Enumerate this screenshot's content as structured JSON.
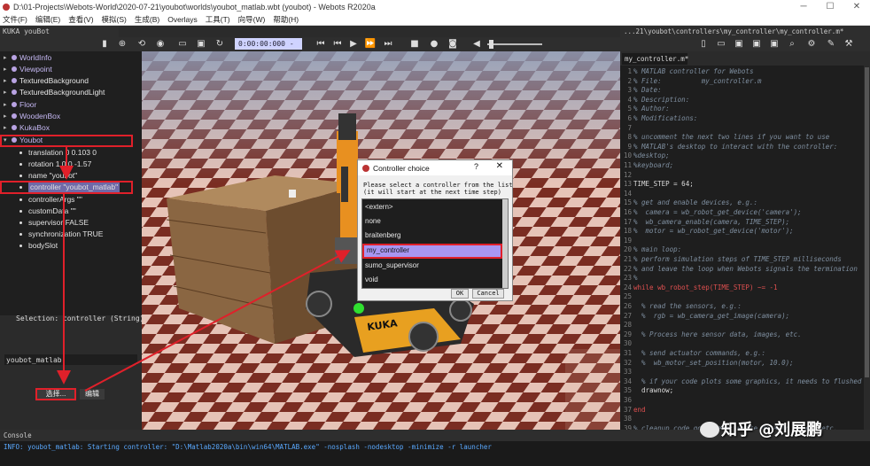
{
  "window": {
    "title": "D:\\01-Projects\\Webots-World\\2020-07-21\\youbot\\worlds\\youbot_matlab.wbt (youbot) - Webots R2020a"
  },
  "menu": [
    "文件(F)",
    "编辑(E)",
    "查看(V)",
    "模拟(S)",
    "生成(B)",
    "Overlays",
    "工具(T)",
    "向导(W)",
    "帮助(H)"
  ],
  "scene_title": "KUKA youBot",
  "simulation": {
    "time": "0:00:00:000",
    "speed": "- 0.00x"
  },
  "scene_tree": {
    "nodes": [
      "WorldInfo",
      "Viewpoint",
      "TexturedBackground",
      "TexturedBackgroundLight",
      "Floor",
      "WoodenBox",
      "KukaBox",
      "Youbot"
    ],
    "youbot_fields": [
      "translation 0 0.103 0",
      "rotation 1 0 0 -1.57",
      "name \"youbot\"",
      "controller \"youbot_matlab\"",
      "controllerArgs \"\"",
      "customData \"\"",
      "supervisor FALSE",
      "synchronization TRUE",
      "bodySlot"
    ]
  },
  "selection_label": "Selection: controller (String)",
  "field_value": "youbot_matlab",
  "select_button": "选择...",
  "edit_button": "编辑",
  "dialog": {
    "title": "Controller choice",
    "help": "?",
    "close": "✕",
    "message": "Please select a controller from the list\n(it will start at the next time step)",
    "options": [
      "<extern>",
      "none",
      "braitenberg",
      "my_controller",
      "sumo_supervisor",
      "void"
    ],
    "selected": "my_controller",
    "ok": "OK",
    "cancel": "Cancel"
  },
  "editor": {
    "path": "...21\\youbot\\controllers\\my_controller\\my_controller.m*",
    "tab": "my_controller.m*",
    "lines": [
      {
        "n": "1",
        "t": "% MATLAB controller for Webots",
        "k": "cm"
      },
      {
        "n": "2",
        "t": "% File:          my_controller.m",
        "k": "cm"
      },
      {
        "n": "3",
        "t": "% Date:",
        "k": "cm"
      },
      {
        "n": "4",
        "t": "% Description:",
        "k": "cm"
      },
      {
        "n": "5",
        "t": "% Author:",
        "k": "cm"
      },
      {
        "n": "6",
        "t": "% Modifications:",
        "k": "cm"
      },
      {
        "n": "7",
        "t": "",
        "k": "nm"
      },
      {
        "n": "8",
        "t": "% uncomment the next two lines if you want to use",
        "k": "cm"
      },
      {
        "n": "9",
        "t": "% MATLAB's desktop to interact with the controller:",
        "k": "cm"
      },
      {
        "n": "10",
        "t": "%desktop;",
        "k": "cm"
      },
      {
        "n": "11",
        "t": "%keyboard;",
        "k": "cm"
      },
      {
        "n": "12",
        "t": "",
        "k": "nm"
      },
      {
        "n": "13",
        "t": "TIME_STEP = 64;",
        "k": "nm"
      },
      {
        "n": "14",
        "t": "",
        "k": "nm"
      },
      {
        "n": "15",
        "t": "% get and enable devices, e.g.:",
        "k": "cm"
      },
      {
        "n": "16",
        "t": "%  camera = wb_robot_get_device('camera');",
        "k": "cm"
      },
      {
        "n": "17",
        "t": "%  wb_camera_enable(camera, TIME_STEP);",
        "k": "cm"
      },
      {
        "n": "18",
        "t": "%  motor = wb_robot_get_device('motor');",
        "k": "cm"
      },
      {
        "n": "19",
        "t": "",
        "k": "nm"
      },
      {
        "n": "20",
        "t": "% main loop:",
        "k": "cm"
      },
      {
        "n": "21",
        "t": "% perform simulation steps of TIME_STEP milliseconds",
        "k": "cm"
      },
      {
        "n": "22",
        "t": "% and leave the loop when Webots signals the termination",
        "k": "cm"
      },
      {
        "n": "23",
        "t": "%",
        "k": "cm"
      },
      {
        "n": "24",
        "t": "while wb_robot_step(TIME_STEP) ~= -1",
        "k": "kw"
      },
      {
        "n": "25",
        "t": "",
        "k": "nm"
      },
      {
        "n": "26",
        "t": "  % read the sensors, e.g.:",
        "k": "cm"
      },
      {
        "n": "27",
        "t": "  %  rgb = wb_camera_get_image(camera);",
        "k": "cm"
      },
      {
        "n": "28",
        "t": "",
        "k": "nm"
      },
      {
        "n": "29",
        "t": "  % Process here sensor data, images, etc.",
        "k": "cm"
      },
      {
        "n": "30",
        "t": "",
        "k": "nm"
      },
      {
        "n": "31",
        "t": "  % send actuator commands, e.g.:",
        "k": "cm"
      },
      {
        "n": "32",
        "t": "  %  wb_motor_set_position(motor, 10.0);",
        "k": "cm"
      },
      {
        "n": "33",
        "t": "",
        "k": "nm"
      },
      {
        "n": "34",
        "t": "  % if your code plots some graphics, it needs to flushed",
        "k": "cm"
      },
      {
        "n": "35",
        "t": "  drawnow;",
        "k": "nm"
      },
      {
        "n": "36",
        "t": "",
        "k": "nm"
      },
      {
        "n": "37",
        "t": "end",
        "k": "kw"
      },
      {
        "n": "38",
        "t": "",
        "k": "nm"
      },
      {
        "n": "39",
        "t": "% cleanup code goes here: write data to files, etc.",
        "k": "cm"
      }
    ]
  },
  "console": {
    "title": "Console",
    "lines": [
      "INFO: youbot_matlab: Starting controller: \"D:\\Matlab2020a\\bin\\win64\\MATLAB.exe\" -nosplash -nodesktop -minimize -r launcher"
    ]
  },
  "watermark": "知乎 @刘展鹏"
}
